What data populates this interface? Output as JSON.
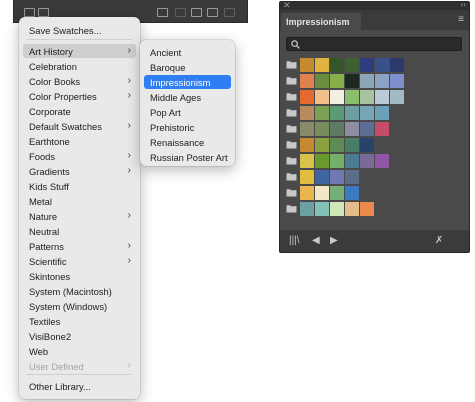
{
  "menu": {
    "items": [
      {
        "label": "Save Swatches...",
        "submenu": false,
        "state": "normal"
      },
      {
        "label": "Art History",
        "submenu": true,
        "state": "active"
      },
      {
        "label": "Celebration",
        "submenu": false,
        "state": "normal"
      },
      {
        "label": "Color Books",
        "submenu": true,
        "state": "normal"
      },
      {
        "label": "Color Properties",
        "submenu": true,
        "state": "normal"
      },
      {
        "label": "Corporate",
        "submenu": false,
        "state": "normal"
      },
      {
        "label": "Default Swatches",
        "submenu": true,
        "state": "normal"
      },
      {
        "label": "Earthtone",
        "submenu": false,
        "state": "normal"
      },
      {
        "label": "Foods",
        "submenu": true,
        "state": "normal"
      },
      {
        "label": "Gradients",
        "submenu": true,
        "state": "normal"
      },
      {
        "label": "Kids Stuff",
        "submenu": false,
        "state": "normal"
      },
      {
        "label": "Metal",
        "submenu": false,
        "state": "normal"
      },
      {
        "label": "Nature",
        "submenu": true,
        "state": "normal"
      },
      {
        "label": "Neutral",
        "submenu": false,
        "state": "normal"
      },
      {
        "label": "Patterns",
        "submenu": true,
        "state": "normal"
      },
      {
        "label": "Scientific",
        "submenu": true,
        "state": "normal"
      },
      {
        "label": "Skintones",
        "submenu": false,
        "state": "normal"
      },
      {
        "label": "System (Macintosh)",
        "submenu": false,
        "state": "normal"
      },
      {
        "label": "System (Windows)",
        "submenu": false,
        "state": "normal"
      },
      {
        "label": "Textiles",
        "submenu": false,
        "state": "normal"
      },
      {
        "label": "VisiBone2",
        "submenu": false,
        "state": "normal"
      },
      {
        "label": "Web",
        "submenu": false,
        "state": "normal"
      },
      {
        "label": "User Defined",
        "submenu": true,
        "state": "disabled"
      },
      {
        "label": "Other Library...",
        "submenu": false,
        "state": "normal"
      }
    ]
  },
  "submenu": {
    "items": [
      {
        "label": "Ancient",
        "selected": false
      },
      {
        "label": "Baroque",
        "selected": false
      },
      {
        "label": "Impressionism",
        "selected": true
      },
      {
        "label": "Middle Ages",
        "selected": false
      },
      {
        "label": "Pop Art",
        "selected": false
      },
      {
        "label": "Prehistoric",
        "selected": false
      },
      {
        "label": "Renaissance",
        "selected": false
      },
      {
        "label": "Russian Poster Art",
        "selected": false
      }
    ]
  },
  "panel": {
    "title": "Impressionism",
    "icons": {
      "close": "close-icon",
      "collapse": "collapse-icon",
      "menu": "panel-menu-icon",
      "search": "search-icon",
      "library": "library-icon",
      "previous": "previous-icon",
      "next": "next-icon",
      "tools": "tools-icon"
    },
    "swatch_groups": [
      [
        "#c68b2d",
        "#e2b33e",
        "#36562a",
        "#3d6131",
        "#2f3d7e",
        "#38508c",
        "#2c3a6a"
      ],
      [
        "#e0824f",
        "#6b8c3f",
        "#87b04b",
        "#1e2a1f",
        "#8aa6b8",
        "#8aa3c4",
        "#7f8fcc"
      ],
      [
        "#e46a2e",
        "#f2c08c",
        "#f3efe3",
        "#8bbf6b",
        "#a7c3a2",
        "#bcc9d6",
        "#a3b9c4"
      ],
      [
        "#b78a60",
        "#7aa153",
        "#5a9a74",
        "#6e9fa0",
        "#76a6b5",
        "#6aa1b8"
      ],
      [
        "#8a8a69",
        "#7a8c5d",
        "#5e7b65",
        "#8e8ea2",
        "#5d6e96",
        "#c44d67"
      ],
      [
        "#c68930",
        "#8ba13f",
        "#5c8b55",
        "#487d66",
        "#2a416a"
      ],
      [
        "#d7c24a",
        "#6a9a2f",
        "#73b06a",
        "#4b7b93",
        "#7a6a98",
        "#8f57a6"
      ],
      [
        "#e0bd3f",
        "#3d66a3",
        "#6f78b0",
        "#5a6e8a"
      ],
      [
        "#e9b64e",
        "#f4e7c6",
        "#76ae7a",
        "#3a7ac0"
      ],
      [
        "#6b9fa2",
        "#83c0b8",
        "#d0e7b8",
        "#e3bd8c",
        "#e98a4a"
      ]
    ]
  }
}
